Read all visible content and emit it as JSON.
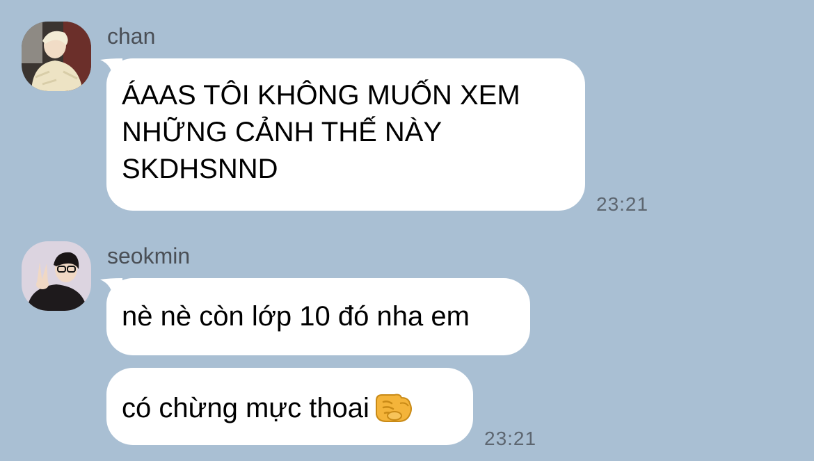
{
  "messages": [
    {
      "sender": "chan",
      "avatar_icon": "user-avatar-photo",
      "bubbles": [
        {
          "lines": [
            "ÁAAS TÔI KHÔNG MUỐN XEM",
            "NHỮNG CẢNH THẾ NÀY",
            "SKDHSNND"
          ],
          "time": "23:21"
        }
      ]
    },
    {
      "sender": "seokmin",
      "avatar_icon": "user-avatar-photo",
      "bubbles": [
        {
          "lines": [
            "nè nè còn lớp 10 đó nha em"
          ],
          "time": ""
        },
        {
          "lines": [
            "có chừng mực thoai"
          ],
          "emoji": "pointing-hand-emoji",
          "time": "23:21"
        }
      ]
    }
  ],
  "colors": {
    "background": "#a9bfd3",
    "bubble": "#ffffff",
    "sender_name": "#4a4f56",
    "timestamp": "#5d6670"
  }
}
